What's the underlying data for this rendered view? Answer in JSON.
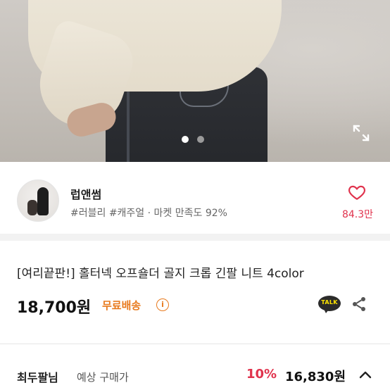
{
  "hero": {
    "slide_count": 2,
    "active_slide": 1,
    "expand_icon": "expand-icon"
  },
  "seller": {
    "name": "럽앤썸",
    "tags": "#러블리 #캐주얼 · 마켓 만족도 92%",
    "likes": "84.3만",
    "heart_icon": "heart-outline-icon",
    "accent_color": "#e0334d"
  },
  "product": {
    "title": "[여리끝판!] 홀터넥 오프숄더 골지 크롭 긴팔 니트 4color",
    "price": "18,700원",
    "shipping": "무료배송",
    "shipping_color": "#e87a1e",
    "info_icon_glyph": "i",
    "talk_label": "TALK",
    "share_icon": "share-icon"
  },
  "bottom": {
    "label": "최두팔님",
    "sub": "예상 구매가",
    "discount": "10%",
    "final_price": "16,830원",
    "chevron_icon": "chevron-up-icon"
  }
}
